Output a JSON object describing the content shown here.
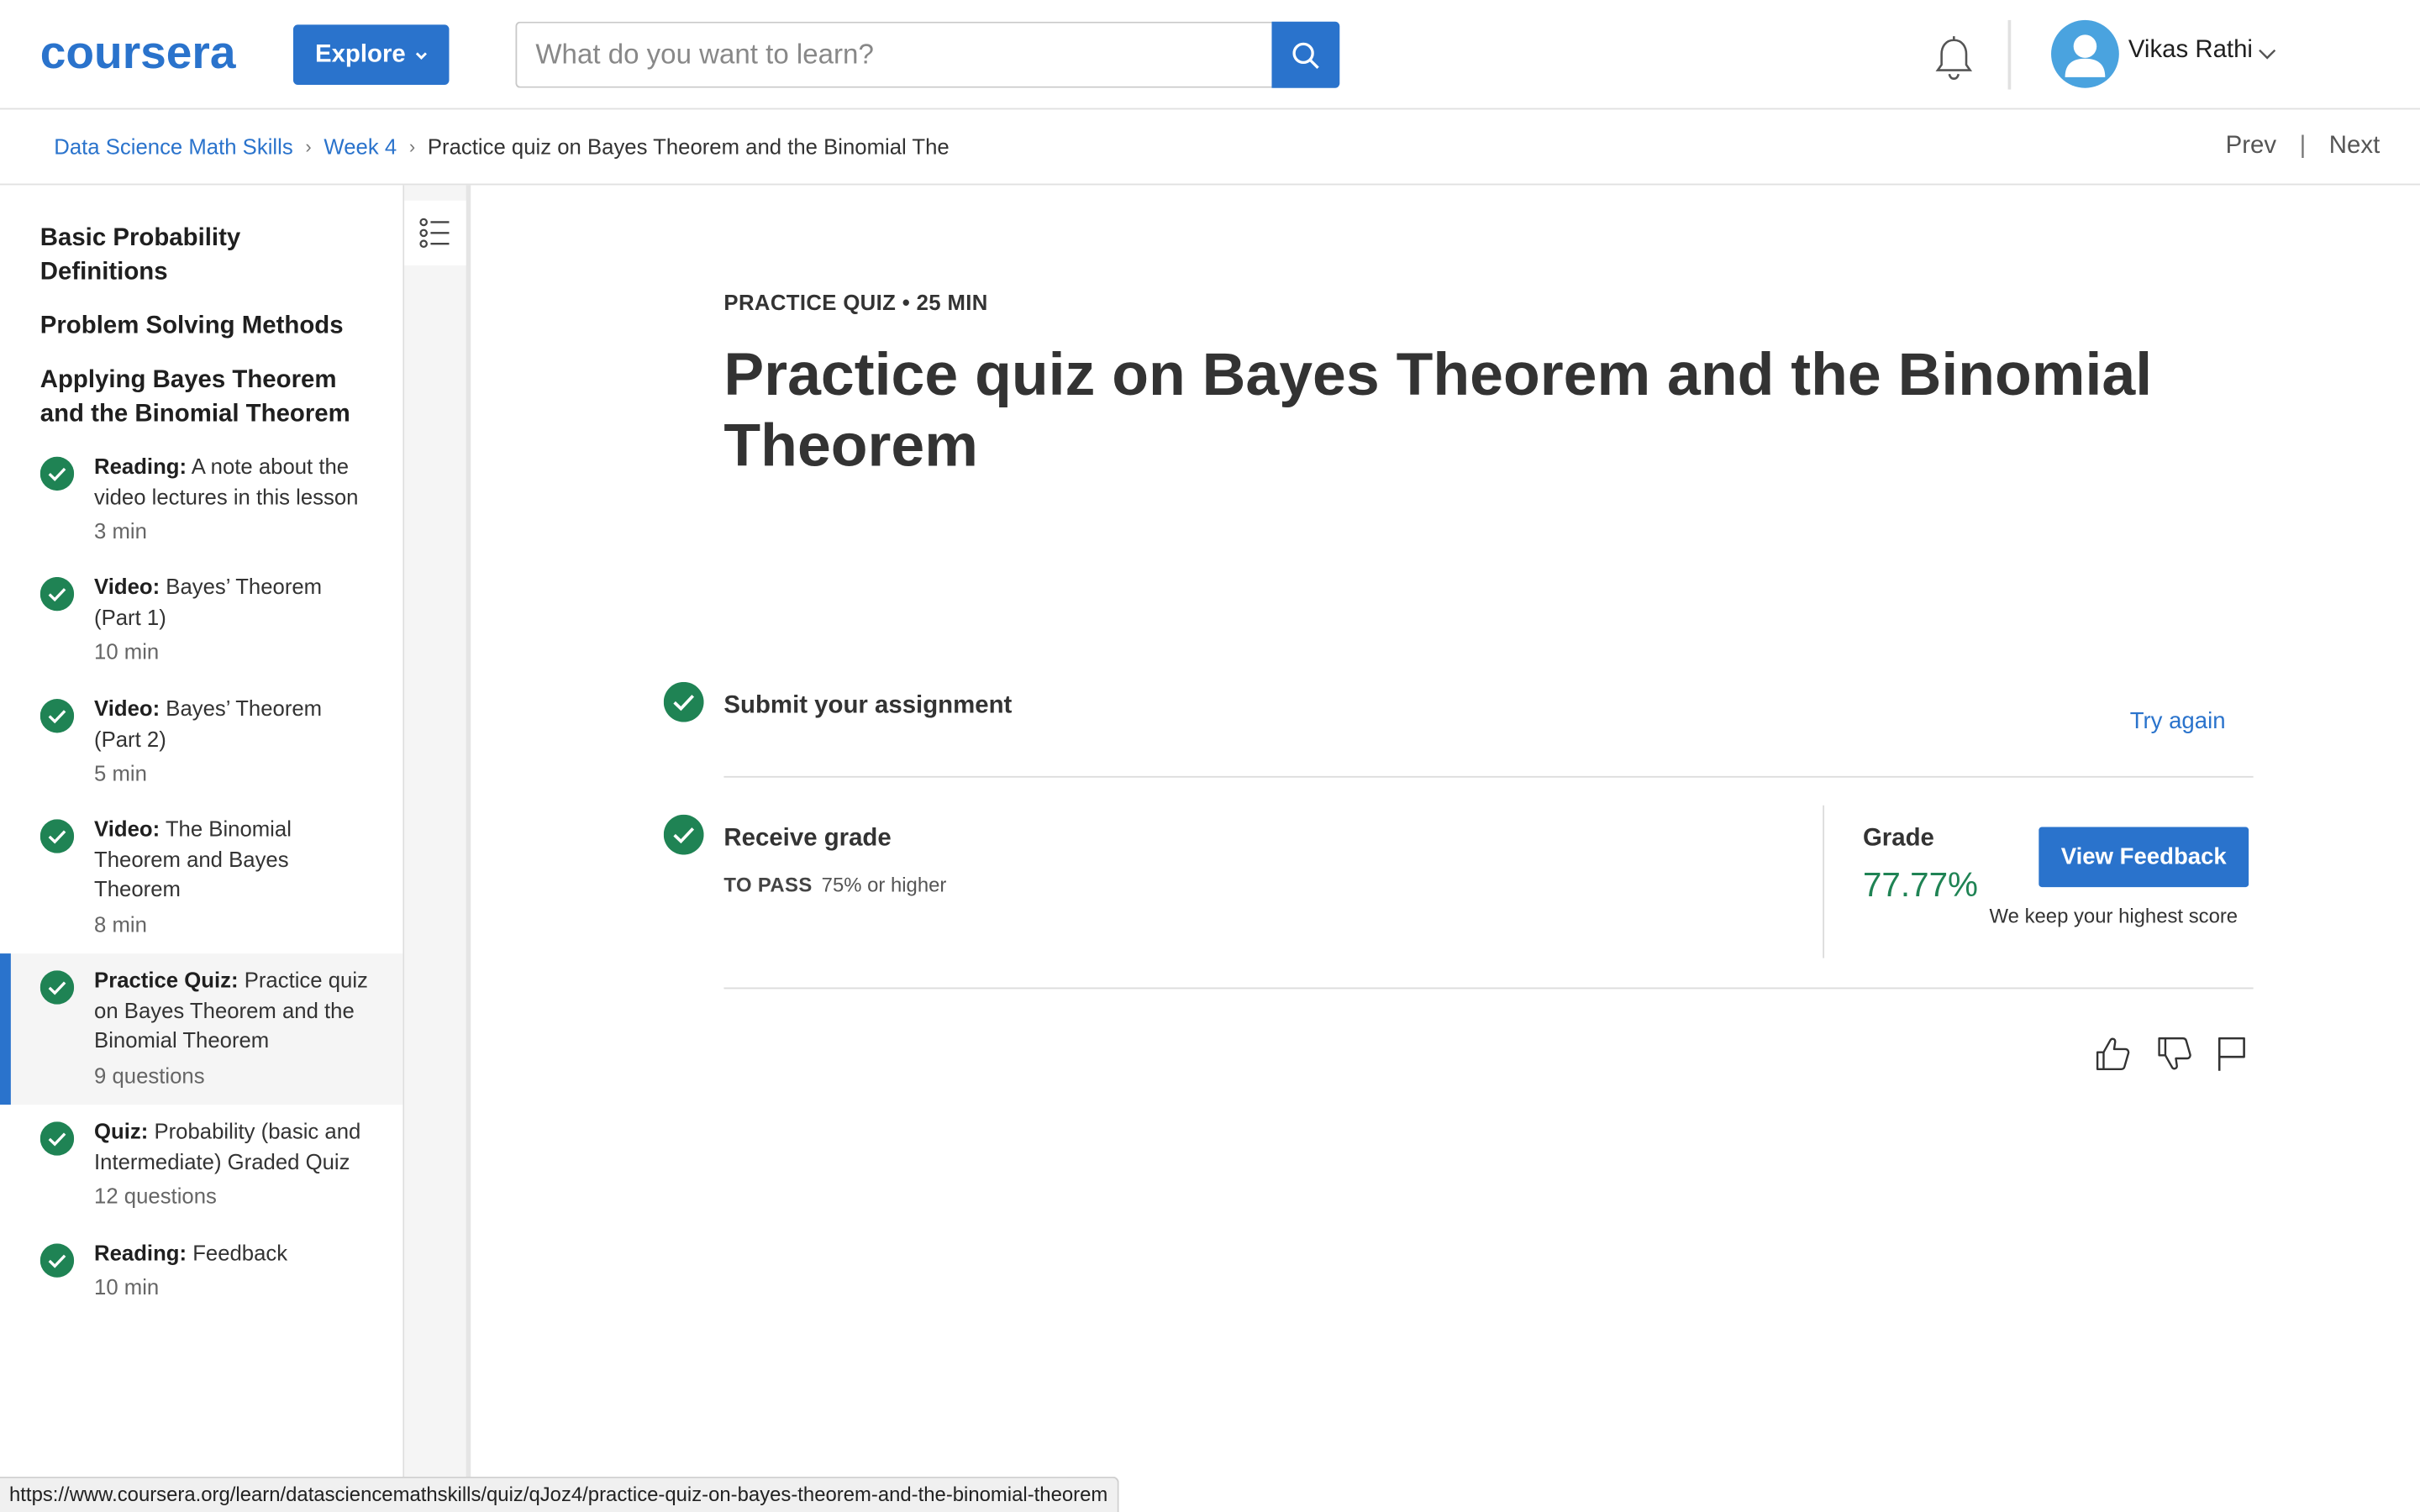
{
  "header": {
    "logo_text": "coursera",
    "explore_label": "Explore",
    "search_placeholder": "What do you want to learn?",
    "user_name": "Vikas Rathi"
  },
  "breadcrumb": {
    "course": "Data Science Math Skills",
    "week": "Week 4",
    "current": "Practice quiz on Bayes Theorem and the Binomial The",
    "prev_label": "Prev",
    "next_label": "Next"
  },
  "sidebar": {
    "sections": [
      "Basic Probability Definitions",
      "Problem Solving Methods",
      "Applying Bayes Theorem and the Binomial Theorem"
    ],
    "items": [
      {
        "type": "Reading:",
        "title": "A note about the video lectures in this lesson",
        "duration": "3 min"
      },
      {
        "type": "Video:",
        "title": "Bayes’ Theorem (Part 1)",
        "duration": "10 min"
      },
      {
        "type": "Video:",
        "title": "Bayes’ Theorem (Part 2)",
        "duration": "5 min"
      },
      {
        "type": "Video:",
        "title": "The Binomial Theorem and Bayes Theorem",
        "duration": "8 min"
      },
      {
        "type": "Practice Quiz:",
        "title": "Practice quiz on Bayes Theorem and the Binomial Theorem",
        "duration": "9 questions"
      },
      {
        "type": "Quiz:",
        "title": "Probability (basic and Intermediate) Graded Quiz",
        "duration": "12 questions"
      },
      {
        "type": "Reading:",
        "title": "Feedback",
        "duration": "10 min"
      }
    ]
  },
  "main": {
    "eyebrow": "PRACTICE QUIZ • 25 MIN",
    "title": "Practice quiz on Bayes Theorem and the Binomial Theorem",
    "submit_title": "Submit your assignment",
    "try_again": "Try again",
    "receive_title": "Receive grade",
    "to_pass_label": "TO PASS",
    "to_pass_value": "75% or higher",
    "grade_label": "Grade",
    "grade_value": "77.77%",
    "view_feedback": "View Feedback",
    "keep_score": "We keep your highest score"
  },
  "status_url": "https://www.coursera.org/learn/datasciencemathskills/quiz/qJoz4/practice-quiz-on-bayes-theorem-and-the-binomial-theorem",
  "colors": {
    "brand": "#2a73cc",
    "check": "#1f8354",
    "grade": "#1f8354"
  },
  "icons": [
    "search-icon",
    "bell-icon",
    "avatar-icon",
    "chevron-down-icon",
    "list-icon",
    "check-circle-icon",
    "thumbs-up-icon",
    "thumbs-down-icon",
    "flag-icon"
  ]
}
